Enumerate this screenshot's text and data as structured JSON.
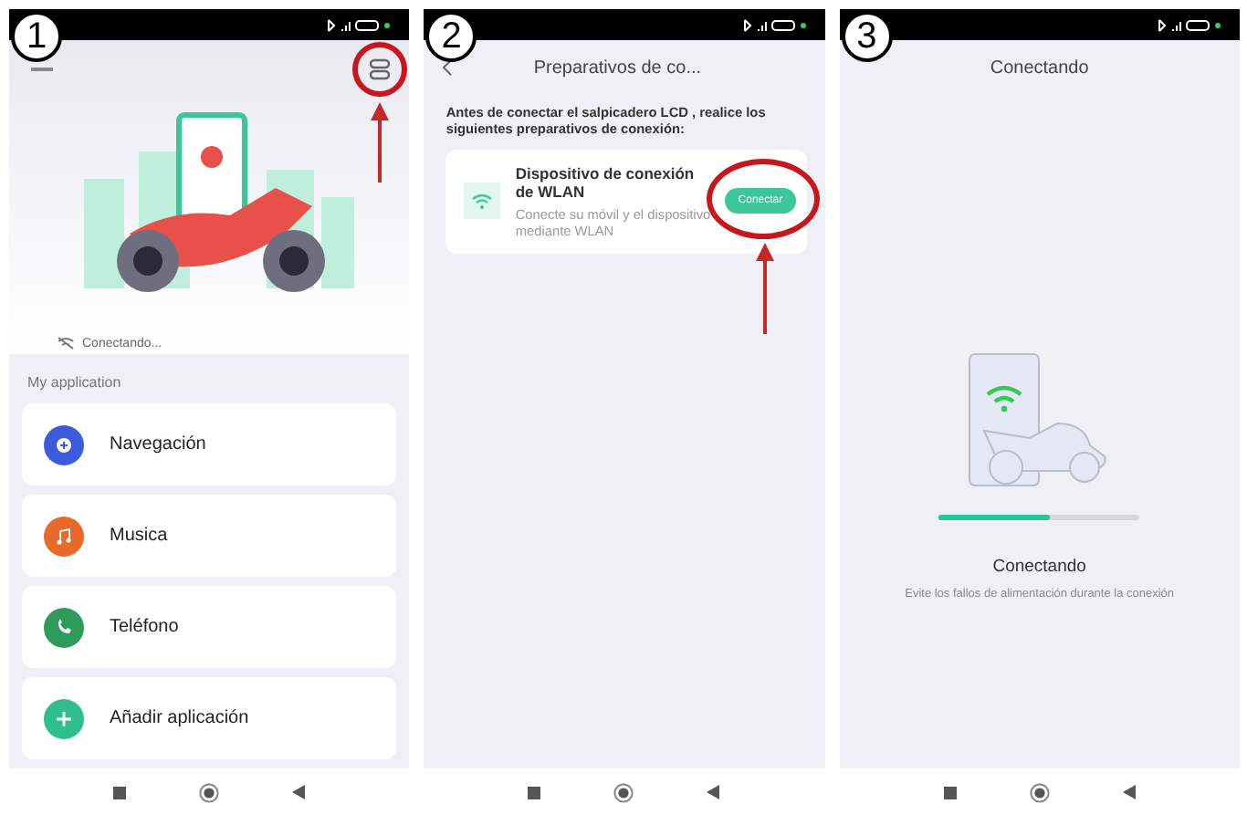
{
  "screens": [
    {
      "kind": "home",
      "number": "1",
      "switch_annotated": true,
      "connection_status": "Conectando...",
      "section_title": "My application",
      "apps": [
        {
          "label": "Navegación",
          "color": "#3b5bdb",
          "kind": "navigation"
        },
        {
          "label": "Musica",
          "color": "#e8692a",
          "kind": "music"
        },
        {
          "label": "Teléfono",
          "color": "#2e9a5c",
          "kind": "phone"
        },
        {
          "label": "Añadir aplicación",
          "color": "#2fbf8a",
          "kind": "add"
        }
      ]
    },
    {
      "kind": "prepare",
      "number": "2",
      "title": "Preparativos de co...",
      "instructions": "Antes de conectar el salpicadero LCD , realice los siguientes preparativos de conexión:",
      "card": {
        "title": "Dispositivo de conexión de WLAN",
        "description": "Conecte su móvil y el dispositivo mediante WLAN",
        "button": "Conectar",
        "button_annotated": true
      }
    },
    {
      "kind": "connecting",
      "number": "3",
      "title": "Conectando",
      "progress": {
        "level": 0.55
      },
      "status": "Conectando",
      "hint": "Evite los fallos de alimentación durante la conexión"
    }
  ]
}
